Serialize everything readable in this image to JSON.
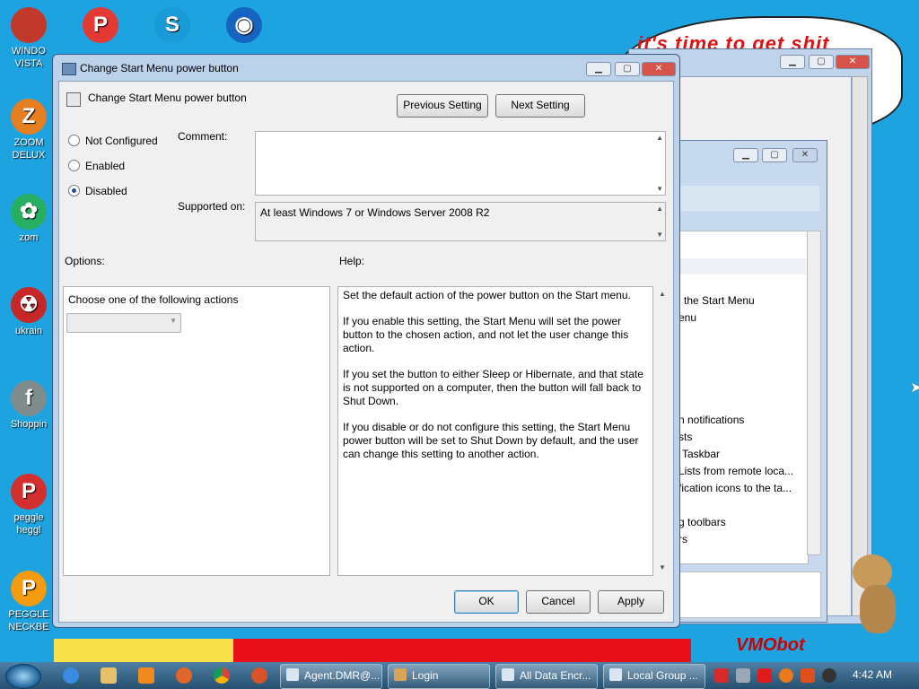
{
  "wallpaper": {
    "cloud_text": "it's time to get shit",
    "watermark": "VMObot"
  },
  "desktop_icons": [
    {
      "label": "WINDO\nVISTA",
      "color": "#c0392b"
    },
    {
      "label": "",
      "color": "#e53935",
      "glyph": "P"
    },
    {
      "label": "",
      "color": "#1a9ad6",
      "glyph": "S"
    },
    {
      "label": "",
      "color": "#1565c0",
      "glyph": "◉"
    },
    {
      "label": "ZOOM\nDELUX",
      "color": "#e67e22",
      "glyph": "Z"
    },
    {
      "label": "zom",
      "color": "#27ae60",
      "glyph": "✿"
    },
    {
      "label": "ukrain",
      "color": "#c62828",
      "glyph": "☢"
    },
    {
      "label": "Shoppin",
      "color": "#7f8c8d",
      "glyph": "f"
    },
    {
      "label": "peggle\nheggl",
      "color": "#d32f2f",
      "glyph": "P"
    },
    {
      "label": "PEGGLE\nNECKBE",
      "color": "#f39c12",
      "glyph": "P"
    }
  ],
  "dialog": {
    "title": "Change Start Menu power button",
    "header_label": "Change Start Menu power button",
    "previous_setting": "Previous Setting",
    "next_setting": "Next Setting",
    "radio_not_configured": "Not Configured",
    "radio_enabled": "Enabled",
    "radio_disabled": "Disabled",
    "selected_option": "Disabled",
    "comment_label": "Comment:",
    "comment_value": "",
    "supported_label": "Supported on:",
    "supported_value": "At least Windows 7 or Windows Server 2008 R2",
    "options_label": "Options:",
    "help_label": "Help:",
    "options_prompt": "Choose one of the following actions",
    "dropdown_value": "",
    "help_paragraphs": [
      "Set the default action of the power button on the Start menu.",
      "If you enable this setting, the Start Menu will set the power button to the chosen action, and not let the user change this action.",
      "If you set the button to either Sleep or Hibernate, and that state is not supported on a computer, then the button will fall back to Shut Down.",
      "If you disable or do not configure this setting, the Start Menu power button will be set to Shut Down by default, and the user can change this setting to another action."
    ],
    "ok": "OK",
    "cancel": "Cancel",
    "apply": "Apply"
  },
  "background_list": [
    "the Start Menu",
    "enu",
    "n notifications",
    "sts",
    "Taskbar",
    "Lists from remote loca...",
    "fication icons to the ta...",
    "g toolbars",
    "rs"
  ],
  "taskbar": {
    "items": [
      "Agent.DMR@...",
      "Login",
      "All Data Encr...",
      "Local Group ..."
    ],
    "clock": "4:42 AM"
  }
}
